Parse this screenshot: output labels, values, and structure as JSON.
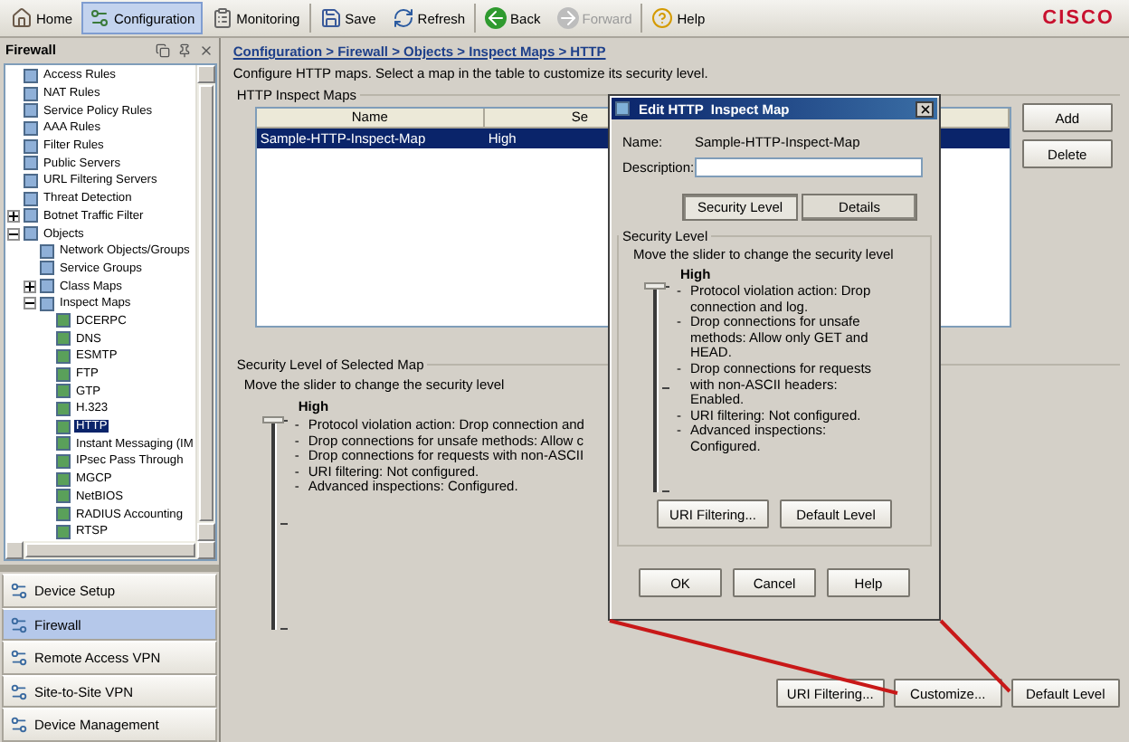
{
  "toolbar": {
    "items": [
      {
        "label": "Home",
        "selected": false,
        "disabled": false
      },
      {
        "label": "Configuration",
        "selected": true,
        "disabled": false
      },
      {
        "label": "Monitoring",
        "selected": false,
        "disabled": false
      },
      {
        "label": "Save",
        "selected": false,
        "disabled": false
      },
      {
        "label": "Refresh",
        "selected": false,
        "disabled": false
      },
      {
        "label": "Back",
        "selected": false,
        "disabled": false
      },
      {
        "label": "Forward",
        "selected": false,
        "disabled": true
      },
      {
        "label": "Help",
        "selected": false,
        "disabled": false
      }
    ],
    "logo": "CISCO"
  },
  "left_panel": {
    "title": "Firewall",
    "tree": [
      {
        "label": "Access Rules",
        "selected": false
      },
      {
        "label": "NAT Rules",
        "selected": false
      },
      {
        "label": "Service Policy Rules",
        "selected": false
      },
      {
        "label": "AAA Rules",
        "selected": false
      },
      {
        "label": "Filter Rules",
        "selected": false
      },
      {
        "label": "Public Servers",
        "selected": false
      },
      {
        "label": "URL Filtering Servers",
        "selected": false
      },
      {
        "label": "Threat Detection",
        "selected": false
      },
      {
        "label": "Botnet Traffic Filter",
        "selected": false,
        "expanded": false
      },
      {
        "label": "Objects",
        "selected": false,
        "expanded": true,
        "children": [
          {
            "label": "Network Objects/Groups",
            "selected": false
          },
          {
            "label": "Service Groups",
            "selected": false
          },
          {
            "label": "Class Maps",
            "selected": false,
            "expanded": false
          },
          {
            "label": "Inspect Maps",
            "selected": false,
            "expanded": true,
            "children": [
              {
                "label": "DCERPC",
                "selected": false
              },
              {
                "label": "DNS",
                "selected": false
              },
              {
                "label": "ESMTP",
                "selected": false
              },
              {
                "label": "FTP",
                "selected": false
              },
              {
                "label": "GTP",
                "selected": false
              },
              {
                "label": "H.323",
                "selected": false
              },
              {
                "label": "HTTP",
                "selected": true
              },
              {
                "label": "Instant Messaging (IM",
                "selected": false
              },
              {
                "label": "IPsec Pass Through",
                "selected": false
              },
              {
                "label": "MGCP",
                "selected": false
              },
              {
                "label": "NetBIOS",
                "selected": false
              },
              {
                "label": "RADIUS Accounting",
                "selected": false
              },
              {
                "label": "RTSP",
                "selected": false
              }
            ]
          }
        ]
      }
    ],
    "nav": [
      {
        "label": "Device Setup",
        "selected": false
      },
      {
        "label": "Firewall",
        "selected": true
      },
      {
        "label": "Remote Access VPN",
        "selected": false
      },
      {
        "label": "Site-to-Site VPN",
        "selected": false
      },
      {
        "label": "Device Management",
        "selected": false
      }
    ]
  },
  "main": {
    "breadcrumb": "Configuration > Firewall > Objects > Inspect Maps > HTTP",
    "description": "Configure HTTP maps. Select a map in the table to customize its security level.",
    "maps_group": {
      "title": "HTTP Inspect Maps",
      "columns": [
        "Name",
        "Se"
      ],
      "rows": [
        {
          "cells": [
            "Sample-HTTP-Inspect-Map",
            "High"
          ],
          "selected": true
        }
      ],
      "buttons": [
        "Add",
        "Delete"
      ]
    },
    "level_group": {
      "title": "Security Level of Selected Map",
      "hint": "Move the slider to change the security level",
      "level_name": "High",
      "level": 1,
      "bullets": [
        {
          "bullet": "-",
          "text": "Protocol violation action: Drop connection and"
        },
        {
          "bullet": "-",
          "text": "Drop connections for unsafe methods: Allow c"
        },
        {
          "bullet": "-",
          "text": "Drop connections for requests with non-ASCII"
        },
        {
          "bullet": "-",
          "text": "URI filtering: Not configured."
        },
        {
          "bullet": "-",
          "text": "Advanced inspections: Configured."
        }
      ]
    },
    "buttons": [
      "URI Filtering...",
      "Customize...",
      "Default Level"
    ]
  },
  "dialog": {
    "title": "Edit HTTP  Inspect Map",
    "name_label": "Name:",
    "name_value": "Sample-HTTP-Inspect-Map",
    "description_label": "Description:",
    "tabs": [
      {
        "label": "Security Level",
        "selected": true
      },
      {
        "label": "Details",
        "selected": false
      }
    ],
    "group": {
      "title": "Security Level",
      "hint": "Move the slider to change the security level",
      "level_name": "High",
      "level": 1,
      "bullets": [
        {
          "bullet": "-",
          "text": "Protocol violation action: Drop connection and log."
        },
        {
          "bullet": "-",
          "text": "Drop connections for unsafe methods: Allow only GET and HEAD."
        },
        {
          "bullet": "-",
          "text": "Drop connections for requests with non-ASCII headers: Enabled."
        },
        {
          "bullet": "-",
          "text": "URI filtering: Not configured."
        },
        {
          "bullet": "-",
          "text": "Advanced inspections: Configured."
        }
      ],
      "buttons": [
        "URI Filtering...",
        "Default Level"
      ]
    },
    "buttons": [
      "OK",
      "Cancel",
      "Help"
    ]
  }
}
